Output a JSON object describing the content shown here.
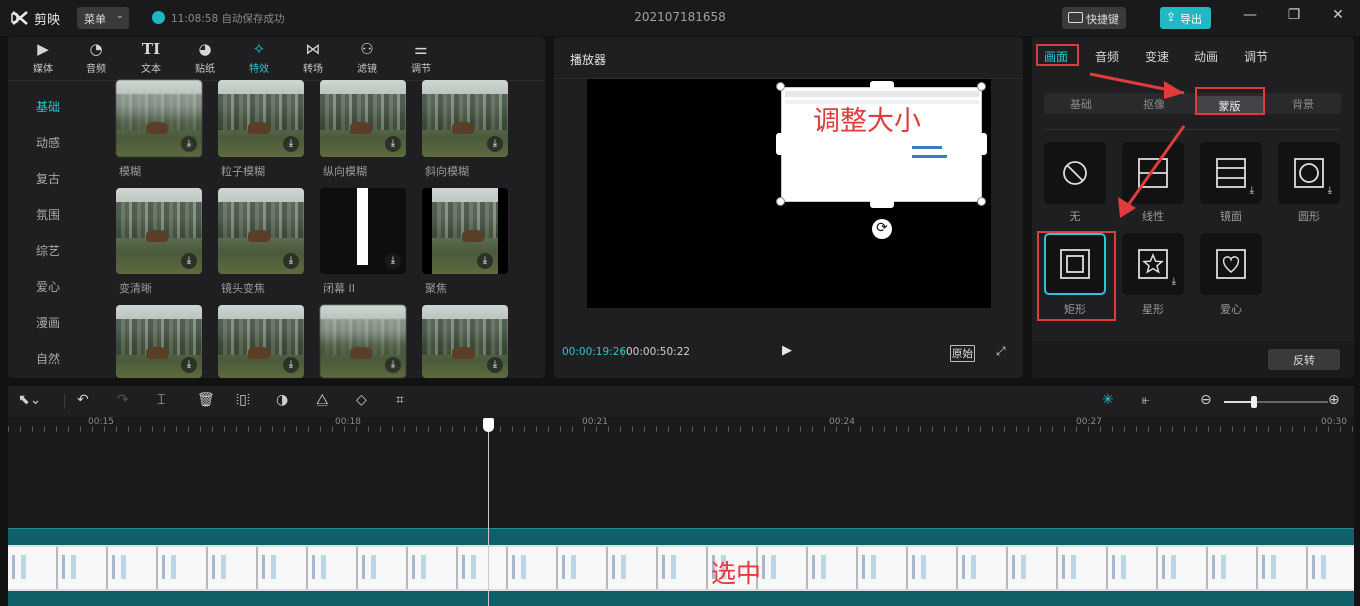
{
  "app": {
    "name": "剪映",
    "menu_label": "菜单",
    "save_status": "11:08:58 自动保存成功",
    "project_name": "202107181658",
    "shortcut_label": "快捷键",
    "export_label": "导出"
  },
  "tool_tabs": [
    {
      "label": "媒体",
      "icon": "media-icon"
    },
    {
      "label": "音频",
      "icon": "audio-icon"
    },
    {
      "label": "文本",
      "icon": "text-icon"
    },
    {
      "label": "贴纸",
      "icon": "sticker-icon"
    },
    {
      "label": "特效",
      "icon": "effects-icon",
      "active": true
    },
    {
      "label": "转场",
      "icon": "transition-icon"
    },
    {
      "label": "滤镜",
      "icon": "filter-icon"
    },
    {
      "label": "调节",
      "icon": "adjust-icon"
    }
  ],
  "categories": [
    "基础",
    "动感",
    "复古",
    "氛围",
    "综艺",
    "爱心",
    "漫画",
    "自然"
  ],
  "effects": [
    "模糊",
    "粒子模糊",
    "纵向模糊",
    "斜向模糊",
    "变清晰",
    "镜头变焦",
    "闭幕 II",
    "聚焦"
  ],
  "player": {
    "title": "播放器",
    "current_time": "00:00:19:26",
    "separator": "|",
    "total_time": "00:00:50:22",
    "ratio_label": "原始",
    "annotation": "调整大小"
  },
  "right_panel": {
    "tabs": [
      "画面",
      "音频",
      "变速",
      "动画",
      "调节"
    ],
    "sub_tabs": [
      "基础",
      "抠像",
      "蒙版",
      "背景"
    ],
    "masks": [
      {
        "label": "无",
        "icon": "none-icon"
      },
      {
        "label": "线性",
        "icon": "linear-mask-icon"
      },
      {
        "label": "镜面",
        "icon": "mirror-mask-icon",
        "download": true
      },
      {
        "label": "圆形",
        "icon": "circle-mask-icon",
        "download": true
      },
      {
        "label": "矩形",
        "icon": "rectangle-mask-icon",
        "selected": true
      },
      {
        "label": "星形",
        "icon": "star-mask-icon",
        "download": true
      },
      {
        "label": "爱心",
        "icon": "heart-mask-icon"
      }
    ],
    "invert_label": "反转"
  },
  "timeline": {
    "ticks": [
      "00:15",
      "00:18",
      "00:21",
      "00:24",
      "00:27",
      "00:30"
    ],
    "annotation": "选中"
  },
  "colors": {
    "accent": "#29c6d3",
    "annotation": "#e23b3b"
  }
}
